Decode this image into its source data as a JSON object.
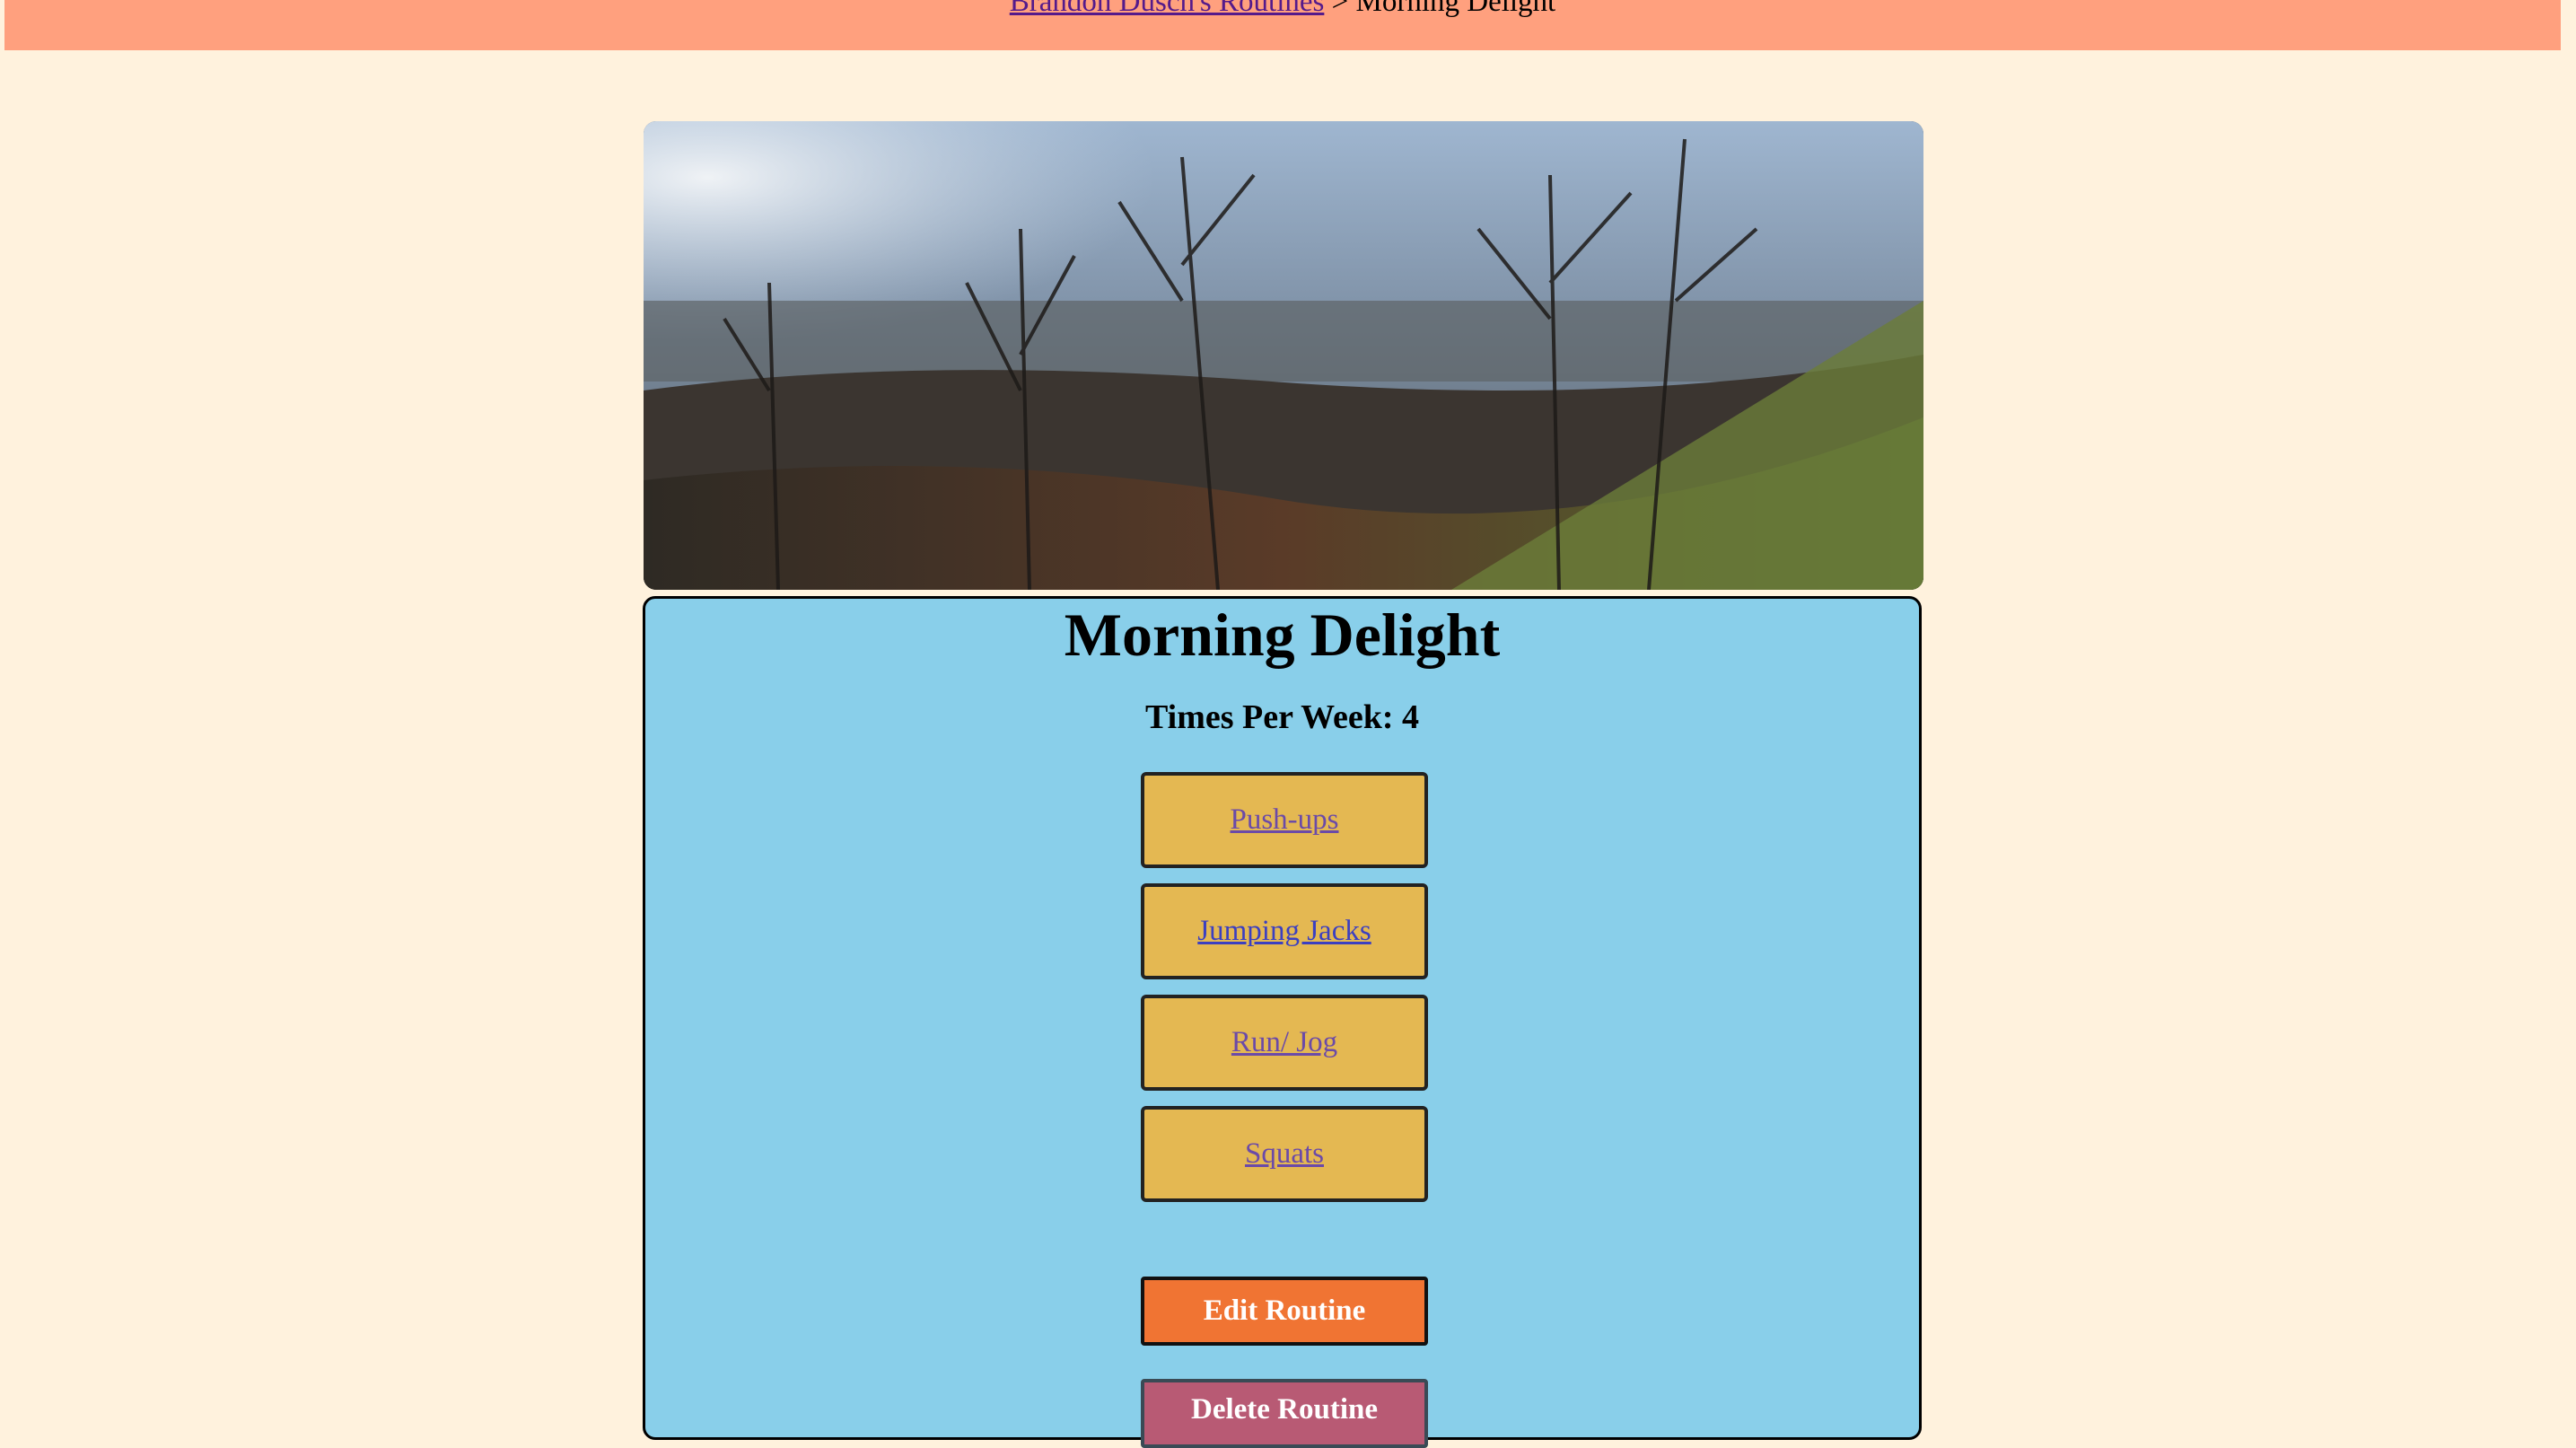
{
  "breadcrumb": {
    "parent_link": "Brandon Dusch's Routines",
    "separator": " > ",
    "current": "Morning Delight"
  },
  "routine": {
    "name": "Morning Delight",
    "times_per_week": "Times Per Week: 4",
    "exercises": [
      "Push-ups",
      "Jumping Jacks",
      "Run/ Jog",
      "Squats"
    ]
  },
  "actions": {
    "edit_label": "Edit Routine",
    "delete_label": "Delete Routine"
  },
  "colors": {
    "page_bg": "#fff2dd",
    "header_bg": "#ffa07e",
    "card_bg": "#89cfea",
    "exercise_bg": "#e4b852",
    "edit_bg": "#f07433",
    "delete_bg": "#b85a74"
  }
}
